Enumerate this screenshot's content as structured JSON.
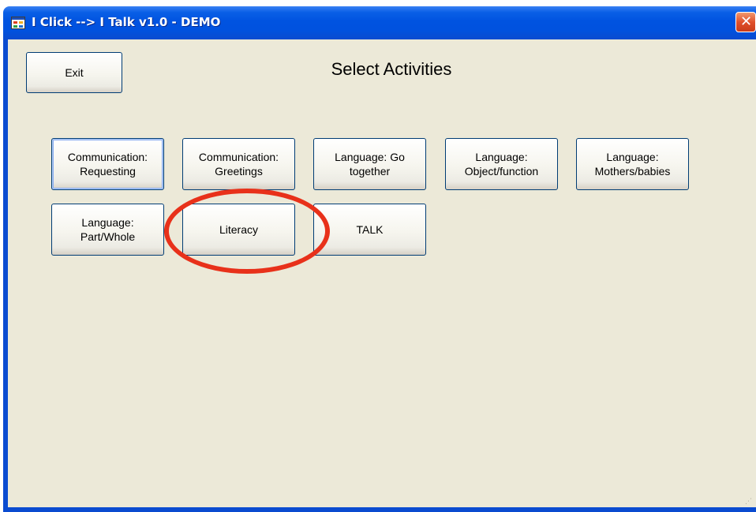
{
  "window": {
    "title": "I Click --> I Talk v1.0 - DEMO",
    "icon": "app-window-icon",
    "close_glyph": "✕"
  },
  "toolbar": {
    "exit_label": "Exit"
  },
  "page": {
    "heading": "Select Activities"
  },
  "activities": {
    "communication_requesting": "Communication: Requesting",
    "communication_greetings": "Communication: Greetings",
    "language_go_together": "Language: Go together",
    "language_object_function": "Language: Object/function",
    "language_mothers_babies": "Language: Mothers/babies",
    "language_part_whole": "Language: Part/Whole",
    "literacy": "Literacy",
    "talk": "TALK"
  },
  "annotation": {
    "highlight_color": "#e8311a",
    "highlighted_item": "Literacy"
  },
  "colors": {
    "titlebar": "#0052df",
    "client_background": "#ece9d8",
    "button_border": "#003c74",
    "close_button": "#e0502b"
  }
}
